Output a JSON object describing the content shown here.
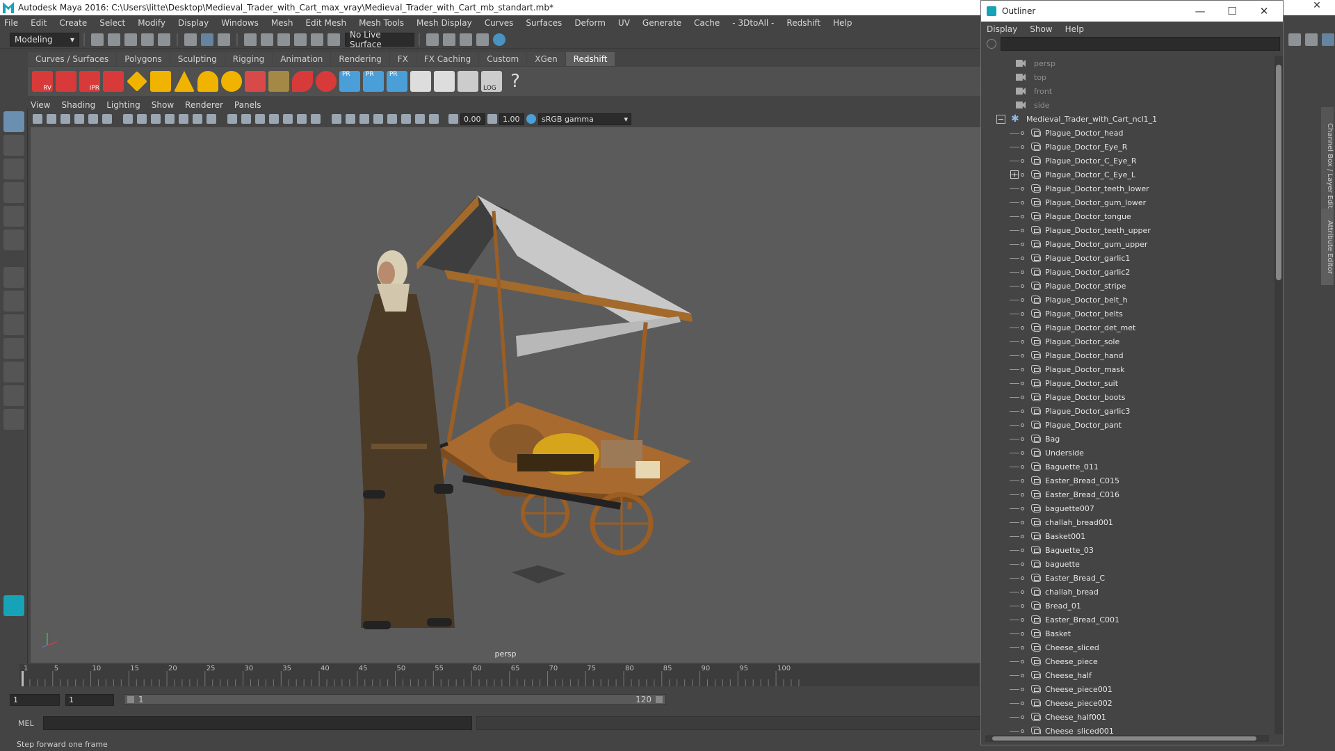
{
  "window": {
    "title": "Autodesk Maya 2016: C:\\Users\\litte\\Desktop\\Medieval_Trader_with_Cart_max_vray\\Medieval_Trader_with_Cart_mb_standart.mb*"
  },
  "menubar": [
    "File",
    "Edit",
    "Create",
    "Select",
    "Modify",
    "Display",
    "Windows",
    "Mesh",
    "Edit Mesh",
    "Mesh Tools",
    "Mesh Display",
    "Curves",
    "Surfaces",
    "Deform",
    "UV",
    "Generate",
    "Cache",
    "- 3DtoAll -",
    "Redshift",
    "Help"
  ],
  "statusline": {
    "mode": "Modeling",
    "live_surface": "No Live Surface"
  },
  "shelf": {
    "tabs": [
      "Curves / Surfaces",
      "Polygons",
      "Sculpting",
      "Rigging",
      "Animation",
      "Rendering",
      "FX",
      "FX Caching",
      "Custom",
      "XGen",
      "Redshift"
    ],
    "active_tab": "Redshift",
    "icon_labels": [
      "RV",
      "IPR",
      "PR",
      "PR",
      "PR",
      "LOG",
      "?"
    ]
  },
  "panel": {
    "menus": [
      "View",
      "Shading",
      "Lighting",
      "Show",
      "Renderer",
      "Panels"
    ],
    "field_a": "0.00",
    "field_b": "1.00",
    "color_space": "sRGB gamma",
    "camera_label": "persp"
  },
  "timeline": {
    "ticks": [
      "1",
      "5",
      "10",
      "15",
      "20",
      "25",
      "30",
      "35",
      "40",
      "45",
      "50",
      "55",
      "60",
      "65",
      "70",
      "75",
      "80",
      "85",
      "90",
      "95",
      "100"
    ],
    "range_start": "1",
    "range_start2": "1",
    "range_inner_start": "1",
    "range_inner_end": "120"
  },
  "cmdline": {
    "label": "MEL"
  },
  "helpline": {
    "text": "Step forward one frame"
  },
  "outliner": {
    "title": "Outliner",
    "menus": [
      "Display",
      "Show",
      "Help"
    ],
    "cameras": [
      "persp",
      "top",
      "front",
      "side"
    ],
    "group": "Medieval_Trader_with_Cart_ncl1_1",
    "items": [
      "Plague_Doctor_head",
      "Plague_Doctor_Eye_R",
      "Plague_Doctor_C_Eye_R",
      "Plague_Doctor_C_Eye_L",
      "Plague_Doctor_teeth_lower",
      "Plague_Doctor_gum_lower",
      "Plague_Doctor_tongue",
      "Plague_Doctor_teeth_upper",
      "Plague_Doctor_gum_upper",
      "Plague_Doctor_garlic1",
      "Plague_Doctor_garlic2",
      "Plague_Doctor_stripe",
      "Plague_Doctor_belt_h",
      "Plague_Doctor_belts",
      "Plague_Doctor_det_met",
      "Plague_Doctor_sole",
      "Plague_Doctor_hand",
      "Plague_Doctor_mask",
      "Plague_Doctor_suit",
      "Plague_Doctor_boots",
      "Plague_Doctor_garlic3",
      "Plague_Doctor_pant",
      "Bag",
      "Underside",
      "Baguette_011",
      "Easter_Bread_C015",
      "Easter_Bread_C016",
      "baguette007",
      "challah_bread001",
      "Basket001",
      "Baguette_03",
      "baguette",
      "Easter_Bread_C",
      "challah_bread",
      "Bread_01",
      "Easter_Bread_C001",
      "Basket",
      "Cheese_sliced",
      "Cheese_piece",
      "Cheese_half",
      "Cheese_piece001",
      "Cheese_piece002",
      "Cheese_half001",
      "Cheese_sliced001"
    ],
    "expandable_index": 3
  },
  "right_tabs": [
    "Channel Box / Layer Editor",
    "Attribute Editor"
  ],
  "colors": {
    "shelf_red": "#d83a3a",
    "shelf_yellow": "#f0b400",
    "active_tool": "#6b8fb0",
    "viewport_bg": "#5b5b5b"
  }
}
